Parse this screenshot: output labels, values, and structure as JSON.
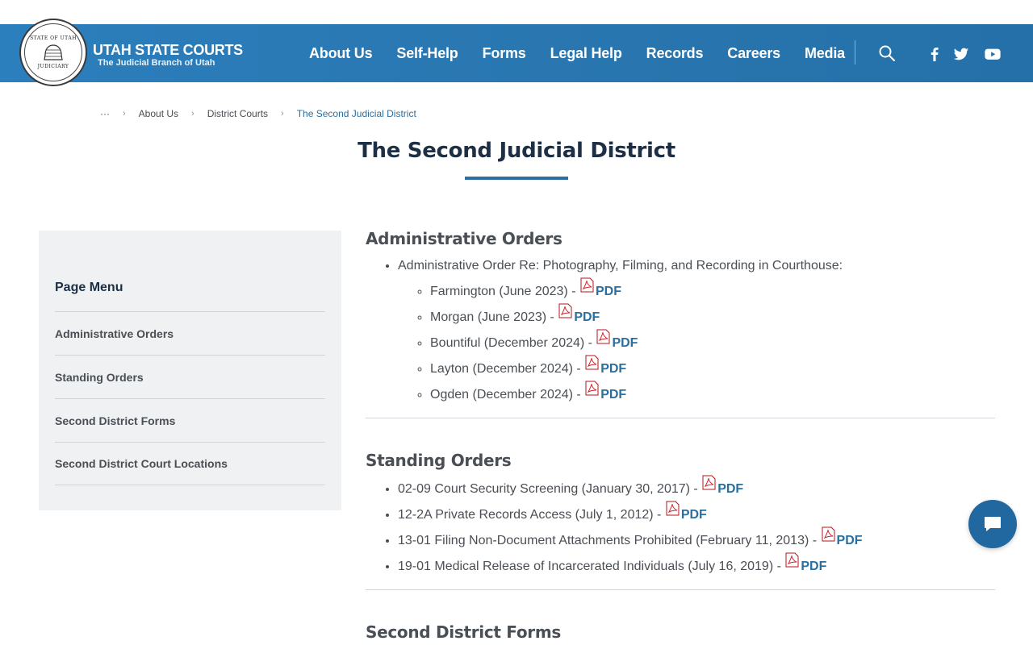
{
  "brand": {
    "seal_top": "STATE OF UTAH",
    "seal_bottom": "JUDICIARY",
    "title": "UTAH STATE COURTS",
    "subtitle": "The Judicial Branch of Utah"
  },
  "nav": [
    "About Us",
    "Self-Help",
    "Forms",
    "Legal Help",
    "Records",
    "Careers",
    "Media"
  ],
  "header_icons": [
    "search-icon",
    "facebook-icon",
    "twitter-icon",
    "youtube-icon"
  ],
  "breadcrumb": {
    "ellipsis": "···",
    "items": [
      "About Us",
      "District Courts",
      "The Second Judicial District"
    ]
  },
  "page_title": "The Second Judicial District",
  "sidebar": {
    "heading": "Page Menu",
    "items": [
      "Administrative Orders",
      "Standing Orders",
      "Second District Forms",
      "Second District Court Locations"
    ]
  },
  "content": {
    "admin_heading": "Administrative Orders",
    "admin_item": "Administrative Order Re: Photography, Filming, and Recording in Courthouse:",
    "admin_sub": [
      {
        "text": "Farmington (June 2023) - ",
        "link": "PDF"
      },
      {
        "text": "Morgan (June 2023) - ",
        "link": "PDF"
      },
      {
        "text": "Bountiful (December 2024) - ",
        "link": "PDF"
      },
      {
        "text": "Layton (December 2024) - ",
        "link": "PDF"
      },
      {
        "text": "Ogden (December 2024) - ",
        "link": "PDF"
      }
    ],
    "standing_heading": "Standing Orders",
    "standing_items": [
      {
        "text": "02-09 Court Security Screening (January 30, 2017) - ",
        "link": "PDF"
      },
      {
        "text": "12-2A Private Records Access (July 1, 2012) - ",
        "link": "PDF"
      },
      {
        "text": "13-01 Filing Non-Document Attachments Prohibited (February 11, 2013) - ",
        "link": "PDF"
      },
      {
        "text": "19-01 Medical Release of Incarcerated Individuals (July 16, 2019) - ",
        "link": "PDF"
      }
    ],
    "forms_heading": "Second District Forms"
  },
  "colors": {
    "header": "#2a78b3",
    "link": "#2a6f9e",
    "title": "#1d2f44",
    "chat": "#2268a0"
  }
}
